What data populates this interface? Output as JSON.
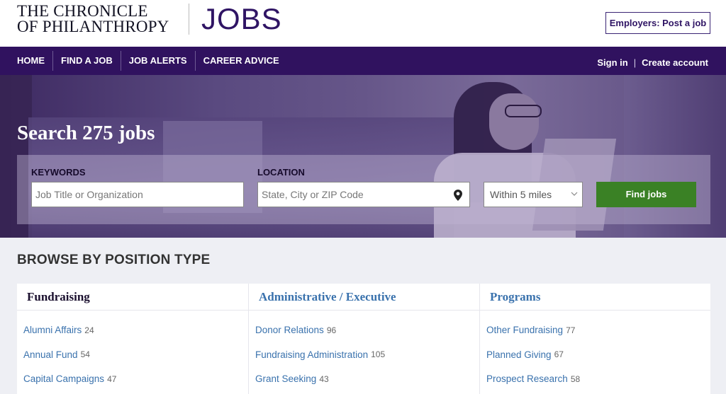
{
  "header": {
    "logo_line1": "THE CHRONICLE",
    "logo_line2": "OF PHILANTHROPY",
    "logo_jobs": "JOBS",
    "post_job_button": "Employers: Post a job"
  },
  "nav": {
    "items": [
      "HOME",
      "FIND A JOB",
      "JOB ALERTS",
      "CAREER ADVICE"
    ],
    "sign_in": "Sign in",
    "separator": "|",
    "create_account": "Create account"
  },
  "hero": {
    "title": "Search 275 jobs",
    "keywords_label": "KEYWORDS",
    "keywords_placeholder": "Job Title or Organization",
    "keywords_value": "",
    "location_label": "LOCATION",
    "location_placeholder": "State, City or ZIP Code",
    "location_value": "",
    "location_icon": "map-pin-icon",
    "radius_selected": "Within 5 miles",
    "radius_icon": "chevron-down-icon",
    "find_button": "Find jobs"
  },
  "browse": {
    "title": "BROWSE BY POSITION TYPE",
    "columns": [
      {
        "heading": "Fundraising",
        "active": true,
        "items": [
          {
            "label": "Alumni Affairs",
            "count": "24"
          },
          {
            "label": "Annual Fund",
            "count": "54"
          },
          {
            "label": "Capital Campaigns",
            "count": "47"
          }
        ]
      },
      {
        "heading": "Administrative / Executive",
        "active": false,
        "items": [
          {
            "label": "Donor Relations",
            "count": "96"
          },
          {
            "label": "Fundraising Administration",
            "count": "105"
          },
          {
            "label": "Grant Seeking",
            "count": "43"
          }
        ]
      },
      {
        "heading": "Programs",
        "active": false,
        "items": [
          {
            "label": "Other Fundraising",
            "count": "77"
          },
          {
            "label": "Planned Giving",
            "count": "67"
          },
          {
            "label": "Prospect Research",
            "count": "58"
          }
        ]
      }
    ]
  },
  "colors": {
    "brand_purple": "#30125f",
    "find_button_green": "#3a8125",
    "link_blue": "#3a72ad"
  }
}
